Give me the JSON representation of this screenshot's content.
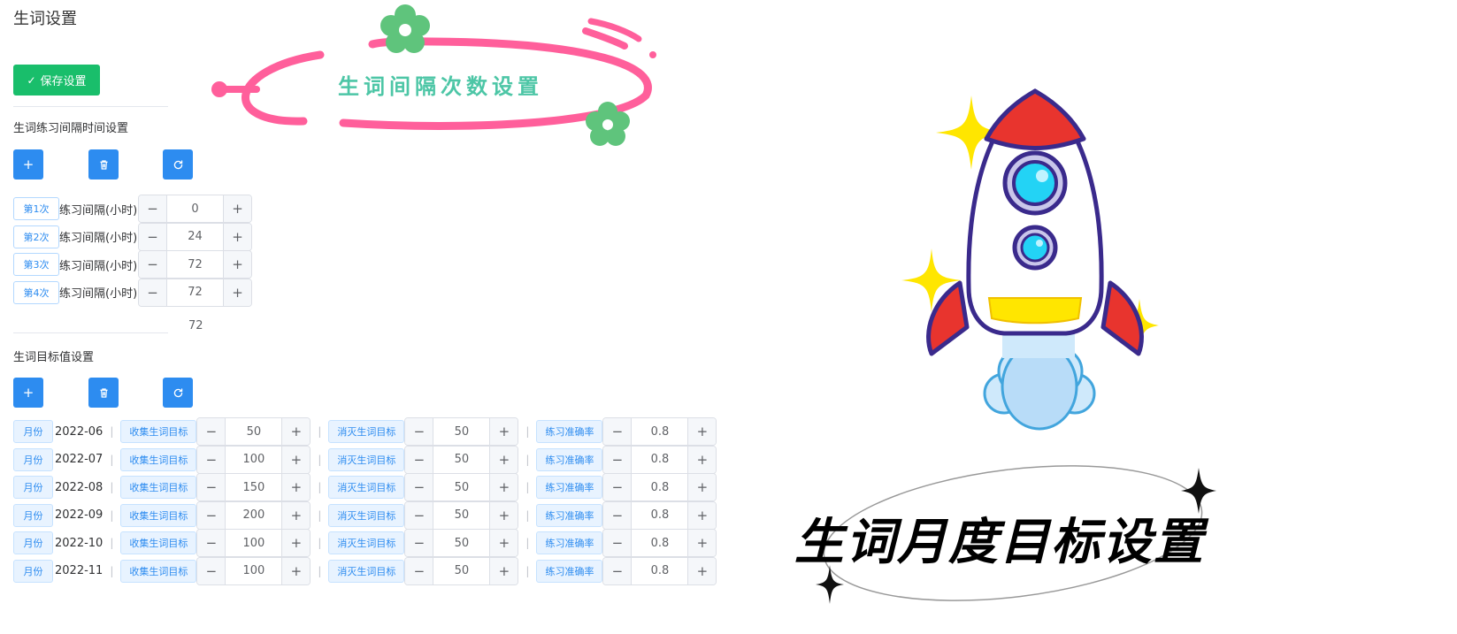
{
  "page": {
    "title": "生词设置"
  },
  "toolbar": {
    "save_label": "保存设置"
  },
  "banner": {
    "title": "生词间隔次数设置"
  },
  "interval_section": {
    "title": "生词练习间隔时间设置",
    "rows": [
      {
        "tag": "第1次",
        "label": "练习间隔(小时)",
        "value": "0"
      },
      {
        "tag": "第2次",
        "label": "练习间隔(小时)",
        "value": "24"
      },
      {
        "tag": "第3次",
        "label": "练习间隔(小时)",
        "value": "72"
      },
      {
        "tag": "第4次",
        "label": "练习间隔(小时)",
        "value": "72"
      }
    ],
    "partial_value": "72"
  },
  "target_section": {
    "title": "生词目标值设置",
    "rows": [
      {
        "month_tag": "月份",
        "month": "2022-06",
        "collect_tag": "收集生词目标",
        "collect": "50",
        "eliminate_tag": "消灭生词目标",
        "eliminate": "50",
        "accuracy_tag": "练习准确率",
        "accuracy": "0.8"
      },
      {
        "month_tag": "月份",
        "month": "2022-07",
        "collect_tag": "收集生词目标",
        "collect": "100",
        "eliminate_tag": "消灭生词目标",
        "eliminate": "50",
        "accuracy_tag": "练习准确率",
        "accuracy": "0.8"
      },
      {
        "month_tag": "月份",
        "month": "2022-08",
        "collect_tag": "收集生词目标",
        "collect": "150",
        "eliminate_tag": "消灭生词目标",
        "eliminate": "50",
        "accuracy_tag": "练习准确率",
        "accuracy": "0.8"
      },
      {
        "month_tag": "月份",
        "month": "2022-09",
        "collect_tag": "收集生词目标",
        "collect": "200",
        "eliminate_tag": "消灭生词目标",
        "eliminate": "50",
        "accuracy_tag": "练习准确率",
        "accuracy": "0.8"
      },
      {
        "month_tag": "月份",
        "month": "2022-10",
        "collect_tag": "收集生词目标",
        "collect": "100",
        "eliminate_tag": "消灭生词目标",
        "eliminate": "50",
        "accuracy_tag": "练习准确率",
        "accuracy": "0.8"
      },
      {
        "month_tag": "月份",
        "month": "2022-11",
        "collect_tag": "收集生词目标",
        "collect": "100",
        "eliminate_tag": "消灭生词目标",
        "eliminate": "50",
        "accuracy_tag": "练习准确率",
        "accuracy": "0.8"
      }
    ]
  },
  "poster": {
    "title": "生词月度目标设置"
  },
  "icons": {
    "add": "plus-icon",
    "delete": "trash-icon",
    "refresh": "refresh-icon",
    "minus": "minus-icon",
    "check": "check-icon",
    "rocket": "rocket-illustration",
    "flower": "flower-icon",
    "sparkle": "sparkle-icon"
  },
  "colors": {
    "primary": "#2d8cf0",
    "success": "#19be6b",
    "banner_pink": "#ff5f9b",
    "banner_text": "#4dc6a6",
    "flower_green": "#5fc47c"
  },
  "symbols": {
    "plus": "+",
    "minus": "−",
    "sep": "|",
    "check": "✓"
  }
}
